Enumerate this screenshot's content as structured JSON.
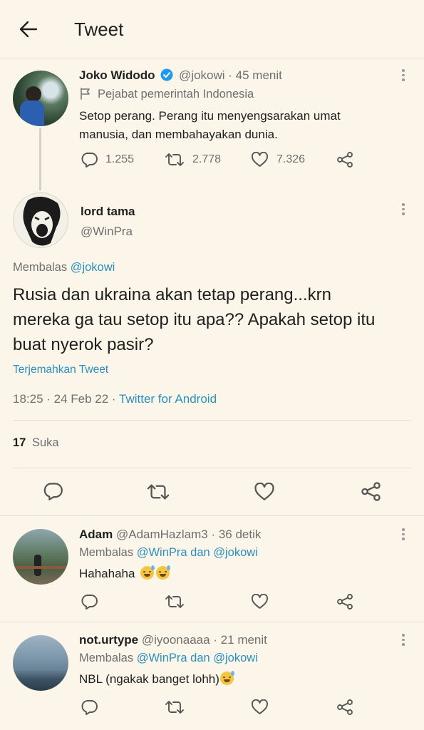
{
  "header": {
    "title": "Tweet"
  },
  "original_tweet": {
    "name": "Joko Widodo",
    "handle": "@jokowi",
    "time": "· 45 menit",
    "label": "Pejabat pemerintah Indonesia",
    "text_line1": "Setop perang. Perang itu menyengsarakan umat",
    "text_line2": "manusia, dan membahayakan dunia.",
    "replies": "1.255",
    "retweets": "2.778",
    "likes": "7.326"
  },
  "main_tweet": {
    "name": "lord tama",
    "handle": "@WinPra",
    "replying_prefix": "Membalas",
    "replying_to": "@jokowi",
    "text_line1": "Rusia dan ukraina akan tetap perang...krn",
    "text_line2": "mereka ga tau setop itu apa?? Apakah setop itu",
    "text_line3": "buat nyerok pasir?",
    "translate": "Terjemahkan Tweet",
    "datetime": "18:25 · 24 Feb 22 ·",
    "source": "Twitter for Android",
    "likes_count": "17",
    "likes_label": "Suka"
  },
  "replies": [
    {
      "name": "Adam",
      "handle": "@AdamHazlam3",
      "time": "· 36 detik",
      "replying_prefix": "Membalas",
      "replying_to": "@WinPra dan @jokowi",
      "text": "Hahahaha"
    },
    {
      "name": "not.urtype",
      "handle": "@iyoonaaaa",
      "time": "· 21 menit",
      "replying_prefix": "Membalas",
      "replying_to": "@WinPra dan @jokowi",
      "text": "NBL (ngakak banget lohh)"
    }
  ],
  "colors": {
    "background": "#fbf6e9",
    "link": "#2a8fc0",
    "verified": "#1d9bf0"
  },
  "icons": [
    "back-arrow-icon",
    "more-icon",
    "flag-icon",
    "verified-icon",
    "reply-icon",
    "retweet-icon",
    "like-icon",
    "share-icon"
  ]
}
